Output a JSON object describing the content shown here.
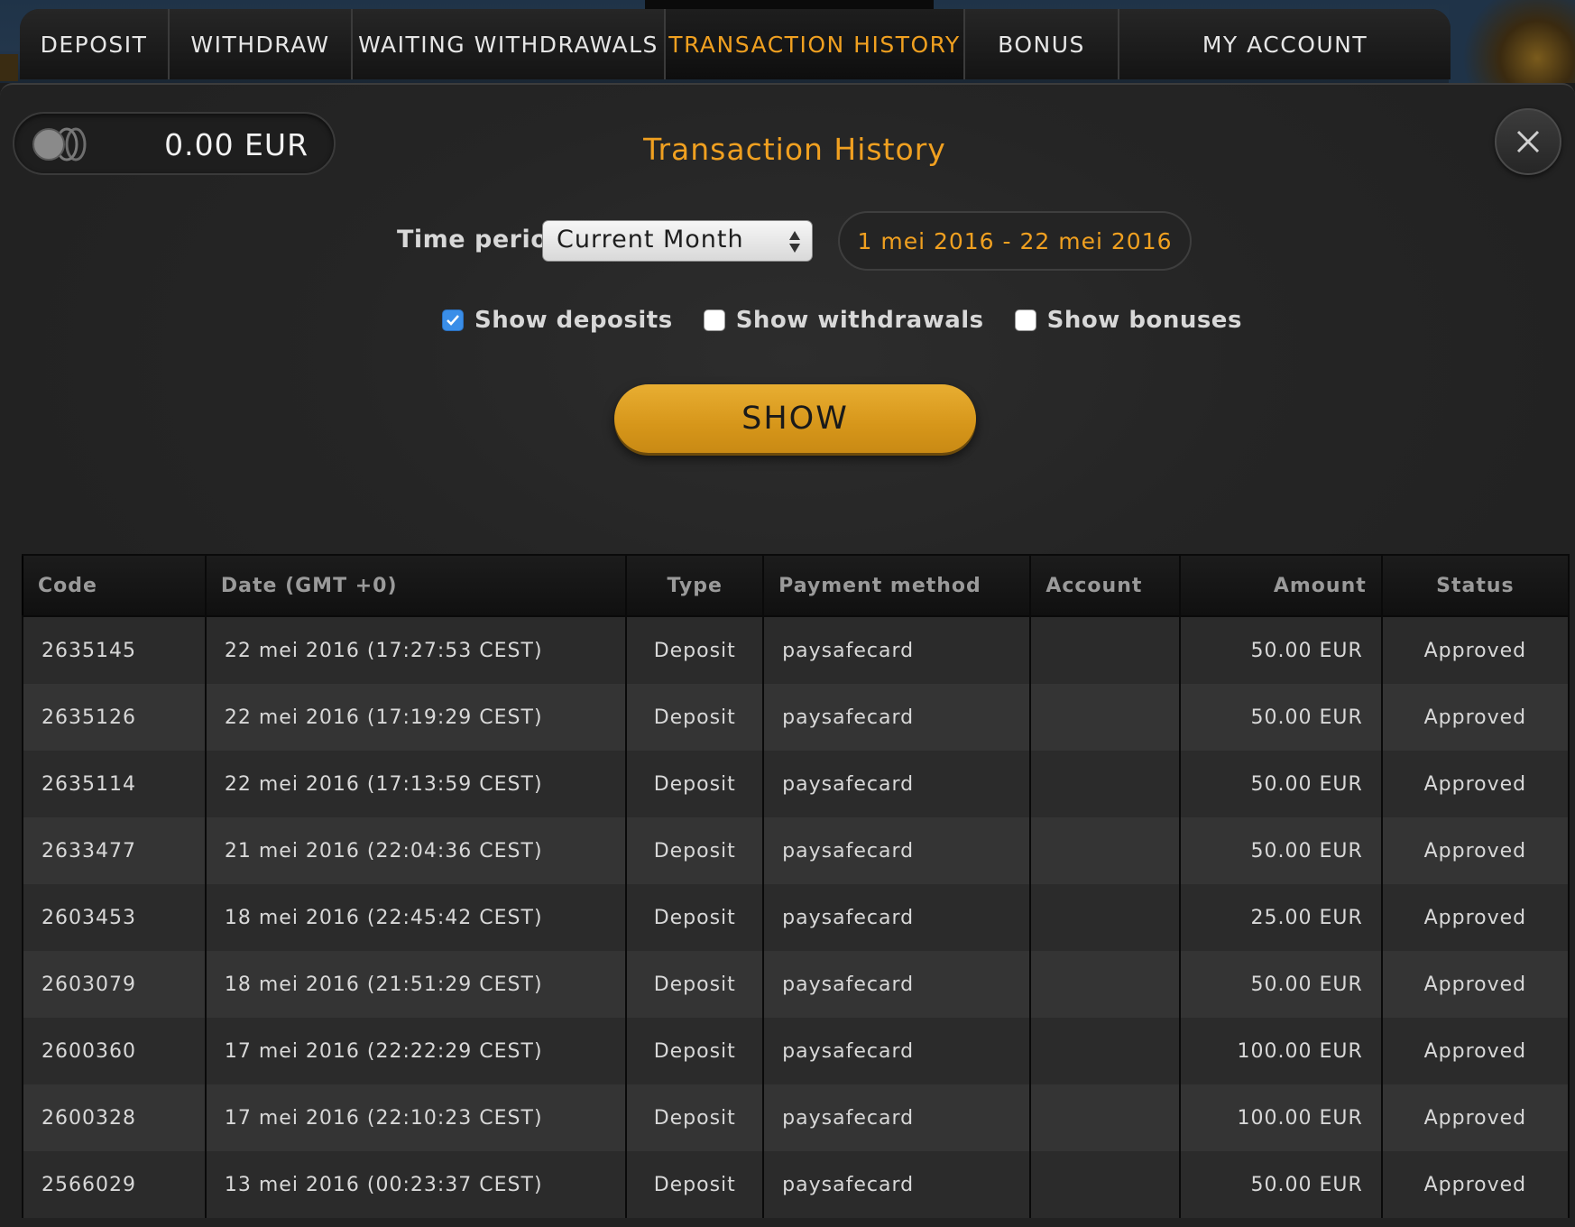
{
  "tabs": [
    {
      "label": "DEPOSIT",
      "active": false
    },
    {
      "label": "WITHDRAW",
      "active": false
    },
    {
      "label": "WAITING WITHDRAWALS",
      "active": false
    },
    {
      "label": "TRANSACTION HISTORY",
      "active": true
    },
    {
      "label": "BONUS",
      "active": false
    },
    {
      "label": "MY ACCOUNT",
      "active": false
    }
  ],
  "balance": {
    "amount": "0.00 EUR",
    "icon": "coins-icon"
  },
  "title": "Transaction History",
  "filters": {
    "time_period_label": "Time period",
    "time_period_value": "Current Month",
    "date_range": "1 mei 2016 - 22 mei 2016",
    "checkboxes": [
      {
        "label": "Show deposits",
        "checked": true
      },
      {
        "label": "Show withdrawals",
        "checked": false
      },
      {
        "label": "Show bonuses",
        "checked": false
      }
    ],
    "show_button": "SHOW"
  },
  "table": {
    "headers": {
      "code": "Code",
      "date": "Date (GMT +0)",
      "type": "Type",
      "payment_method": "Payment method",
      "account": "Account",
      "amount": "Amount",
      "status": "Status"
    },
    "rows": [
      {
        "code": "2635145",
        "date": "22 mei 2016 (17:27:53 CEST)",
        "type": "Deposit",
        "payment_method": "paysafecard",
        "account": "",
        "amount": "50.00 EUR",
        "status": "Approved"
      },
      {
        "code": "2635126",
        "date": "22 mei 2016 (17:19:29 CEST)",
        "type": "Deposit",
        "payment_method": "paysafecard",
        "account": "",
        "amount": "50.00 EUR",
        "status": "Approved"
      },
      {
        "code": "2635114",
        "date": "22 mei 2016 (17:13:59 CEST)",
        "type": "Deposit",
        "payment_method": "paysafecard",
        "account": "",
        "amount": "50.00 EUR",
        "status": "Approved"
      },
      {
        "code": "2633477",
        "date": "21 mei 2016 (22:04:36 CEST)",
        "type": "Deposit",
        "payment_method": "paysafecard",
        "account": "",
        "amount": "50.00 EUR",
        "status": "Approved"
      },
      {
        "code": "2603453",
        "date": "18 mei 2016 (22:45:42 CEST)",
        "type": "Deposit",
        "payment_method": "paysafecard",
        "account": "",
        "amount": "25.00 EUR",
        "status": "Approved"
      },
      {
        "code": "2603079",
        "date": "18 mei 2016 (21:51:29 CEST)",
        "type": "Deposit",
        "payment_method": "paysafecard",
        "account": "",
        "amount": "50.00 EUR",
        "status": "Approved"
      },
      {
        "code": "2600360",
        "date": "17 mei 2016 (22:22:29 CEST)",
        "type": "Deposit",
        "payment_method": "paysafecard",
        "account": "",
        "amount": "100.00 EUR",
        "status": "Approved"
      },
      {
        "code": "2600328",
        "date": "17 mei 2016 (22:10:23 CEST)",
        "type": "Deposit",
        "payment_method": "paysafecard",
        "account": "",
        "amount": "100.00 EUR",
        "status": "Approved"
      },
      {
        "code": "2566029",
        "date": "13 mei 2016 (00:23:37 CEST)",
        "type": "Deposit",
        "payment_method": "paysafecard",
        "account": "",
        "amount": "50.00 EUR",
        "status": "Approved"
      }
    ]
  },
  "colors": {
    "accent": "#f0a020",
    "checkbox_checked": "#3a8ee8",
    "button": "#d6961a"
  }
}
